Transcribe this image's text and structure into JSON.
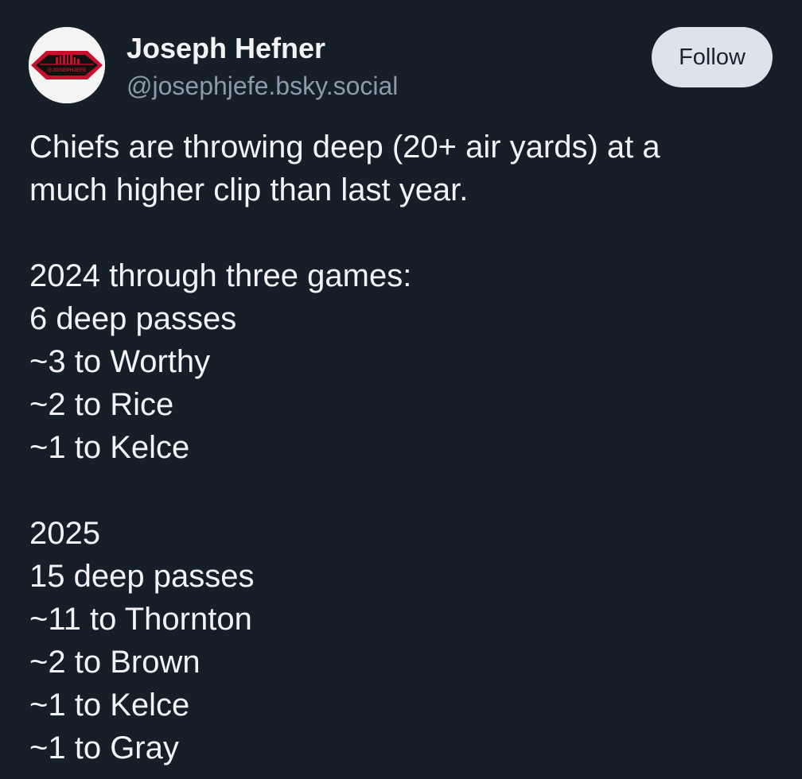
{
  "author": {
    "name": "Joseph Hefner",
    "handle": "@josephjefe.bsky.social",
    "avatar_icon": "arrowhead-logo-icon",
    "avatar_text": "@JOSEPHJEFE"
  },
  "follow_button": {
    "label": "Follow"
  },
  "post": {
    "intro": [
      "Chiefs are throwing deep (20+ air yards) at a",
      "much higher clip than last year."
    ],
    "section_2024": [
      "2024 through three games:",
      "6 deep passes",
      "~3 to Worthy",
      "~2 to Rice",
      "~1 to Kelce"
    ],
    "section_2025": [
      "2025",
      "15 deep passes",
      "~11 to Thornton",
      "~2 to Brown",
      "~1 to Kelce",
      "~1 to Gray"
    ]
  },
  "colors": {
    "background": "#161e27",
    "text": "#f1f3f5",
    "handle": "#8c9aab",
    "follow_bg": "#dde3ea",
    "avatar_red": "#c8102e"
  }
}
